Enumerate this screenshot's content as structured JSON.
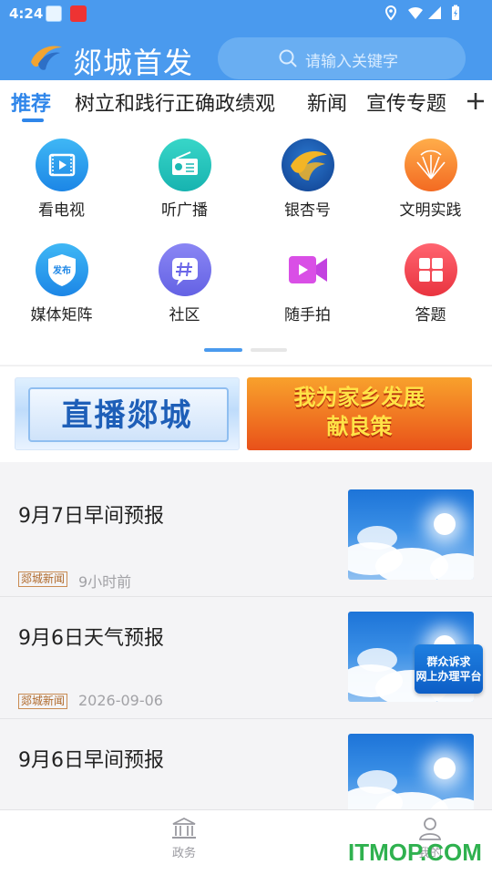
{
  "status_bar": {
    "time": "4:24"
  },
  "header": {
    "brand": "郯城首发",
    "search_placeholder": "请输入关键字"
  },
  "tabs": [
    {
      "label": "推荐",
      "active": true
    },
    {
      "label": "树立和践行正确政绩观"
    },
    {
      "label": "新闻"
    },
    {
      "label": "宣传专题"
    }
  ],
  "shortcuts": [
    {
      "label": "看电视",
      "icon": "tv-icon"
    },
    {
      "label": "听广播",
      "icon": "radio-icon"
    },
    {
      "label": "银杏号",
      "icon": "ginkgo-icon"
    },
    {
      "label": "文明实践",
      "icon": "civilization-icon"
    },
    {
      "label": "媒体矩阵",
      "icon": "media-shield-icon",
      "badge": "发布"
    },
    {
      "label": "社区",
      "icon": "community-hash-icon"
    },
    {
      "label": "随手拍",
      "icon": "video-camera-icon"
    },
    {
      "label": "答题",
      "icon": "quiz-grid-icon"
    }
  ],
  "banners": {
    "left": "直播郯城",
    "right_line1": "我为家乡发展",
    "right_line2": "献良策"
  },
  "news": [
    {
      "title": "9月7日早间预报",
      "source": "郯城新闻",
      "time": "9小时前"
    },
    {
      "title": "9月6日天气预报",
      "source": "郯城新闻",
      "time": "2026-09-06"
    },
    {
      "title": "9月6日早间预报",
      "source": "",
      "time": ""
    }
  ],
  "float_badge": {
    "line1": "群众诉求",
    "line2": "网上办理平台"
  },
  "bottom_nav": [
    {
      "label": "政务",
      "icon": "government-icon"
    },
    {
      "label": "我的",
      "icon": "user-icon"
    }
  ],
  "watermark": "ITMOP.COM",
  "colors": {
    "primary": "#4a9aee",
    "tab_active": "#2f86ea"
  }
}
